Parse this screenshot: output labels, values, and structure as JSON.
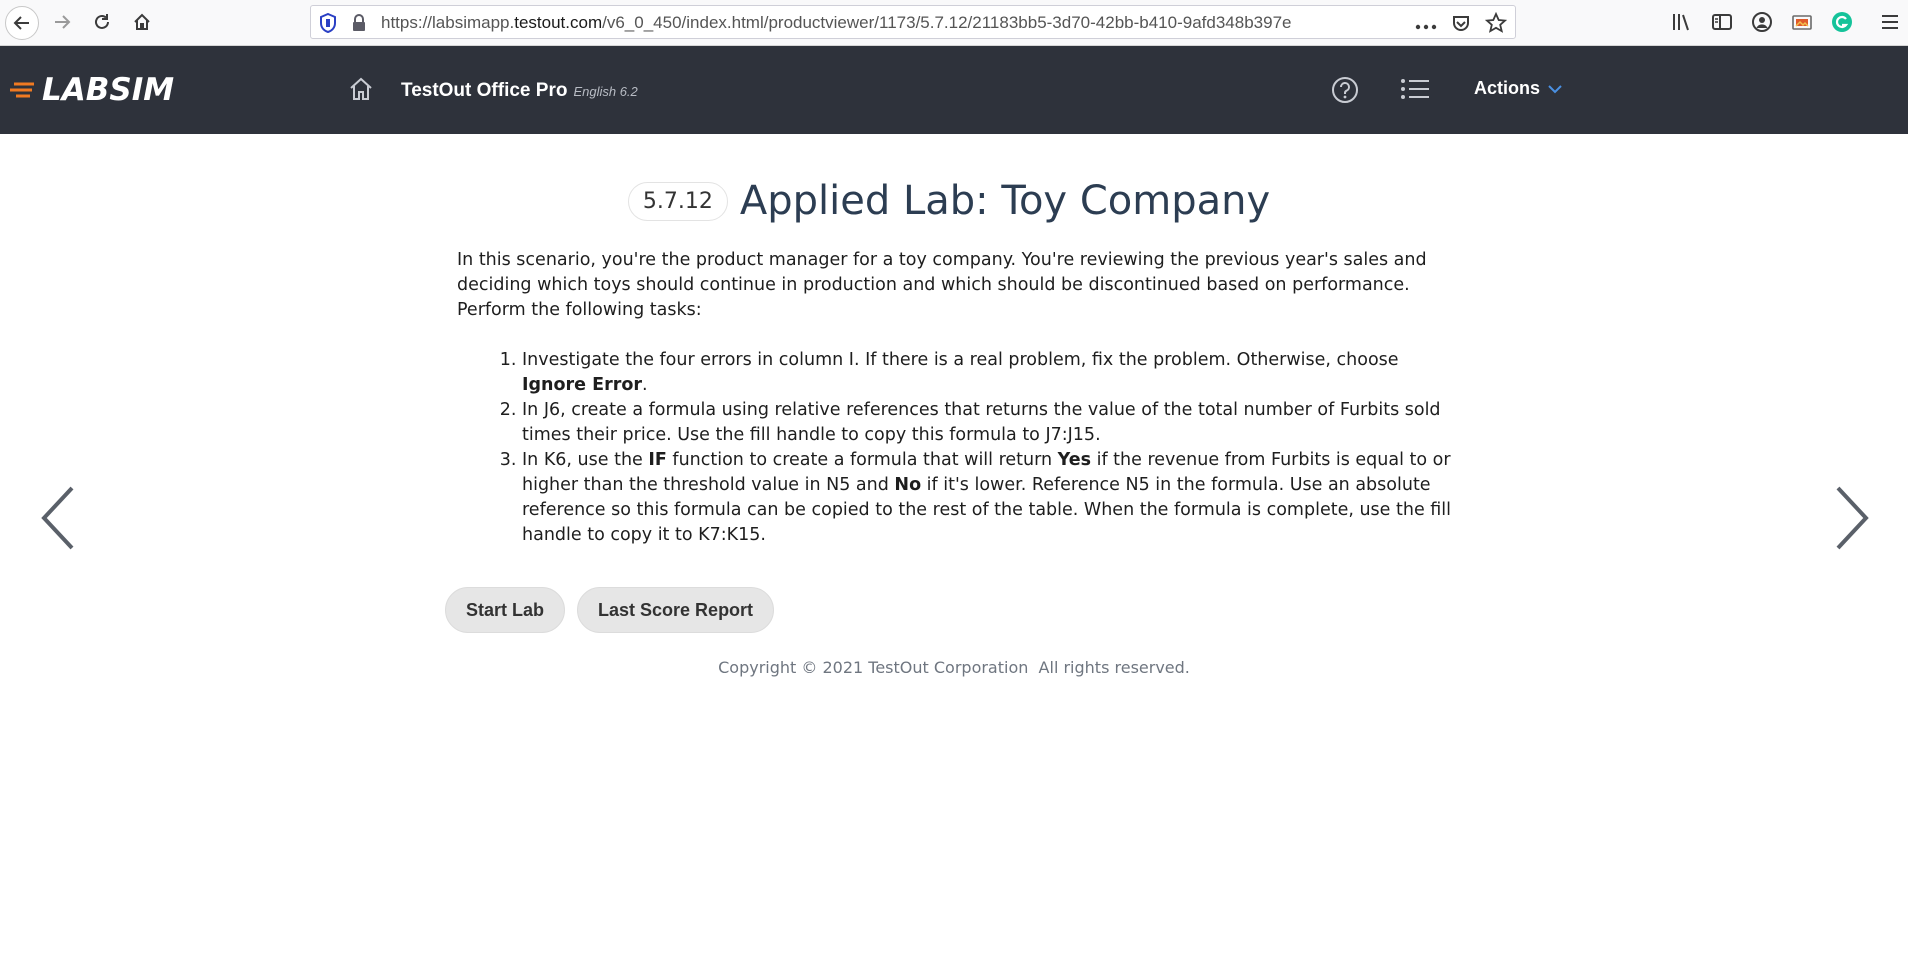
{
  "browser": {
    "url_prefix": "https://labsimapp.",
    "url_host": "testout.com",
    "url_path": "/v6_0_450/index.html/productviewer/1173/5.7.12/21183bb5-3d70-42bb-b410-9afd348b397e"
  },
  "header": {
    "logo_text": "LABSIM",
    "product_name": "TestOut Office Pro",
    "product_version": "English 6.2",
    "actions_label": "Actions"
  },
  "main": {
    "section_number": "5.7.12",
    "title": "Applied Lab: Toy Company",
    "intro": "In this scenario, you're the product manager for a toy company. You're reviewing the previous year's sales and deciding which toys should continue in production and which should be discontinued based on performance. Perform the following tasks:",
    "tasks": [
      {
        "t1": "Investigate the four errors in column I. If there is a real problem, fix the problem. Otherwise, choose ",
        "b1": "Ignore Error",
        "t2": "."
      },
      {
        "t1": "In J6, create a formula using relative references that returns the value of the total number of Furbits sold times their price. Use the fill handle to copy this formula to J7:J15."
      },
      {
        "t1": "In K6, use the ",
        "b1": "IF",
        "t2": " function to create a formula that will return ",
        "b2": "Yes",
        "t3": " if the revenue from Furbits is equal to or higher than the threshold value in N5 and ",
        "b3": "No",
        "t4": " if it's lower. Reference N5 in the formula. Use an absolute reference so this formula can be copied to the rest of the table. When the formula is complete, use the fill handle to copy it to K7:K15."
      }
    ],
    "start_lab_label": "Start Lab",
    "last_score_label": "Last Score Report"
  },
  "footer": {
    "copyright": "Copyright © 2021 TestOut Corporation  All rights reserved."
  },
  "colors": {
    "header_bg": "#2e323b",
    "title_color": "#2c3d52",
    "logo_accent": "#f07a22",
    "actions_chevron": "#4a90e2"
  }
}
